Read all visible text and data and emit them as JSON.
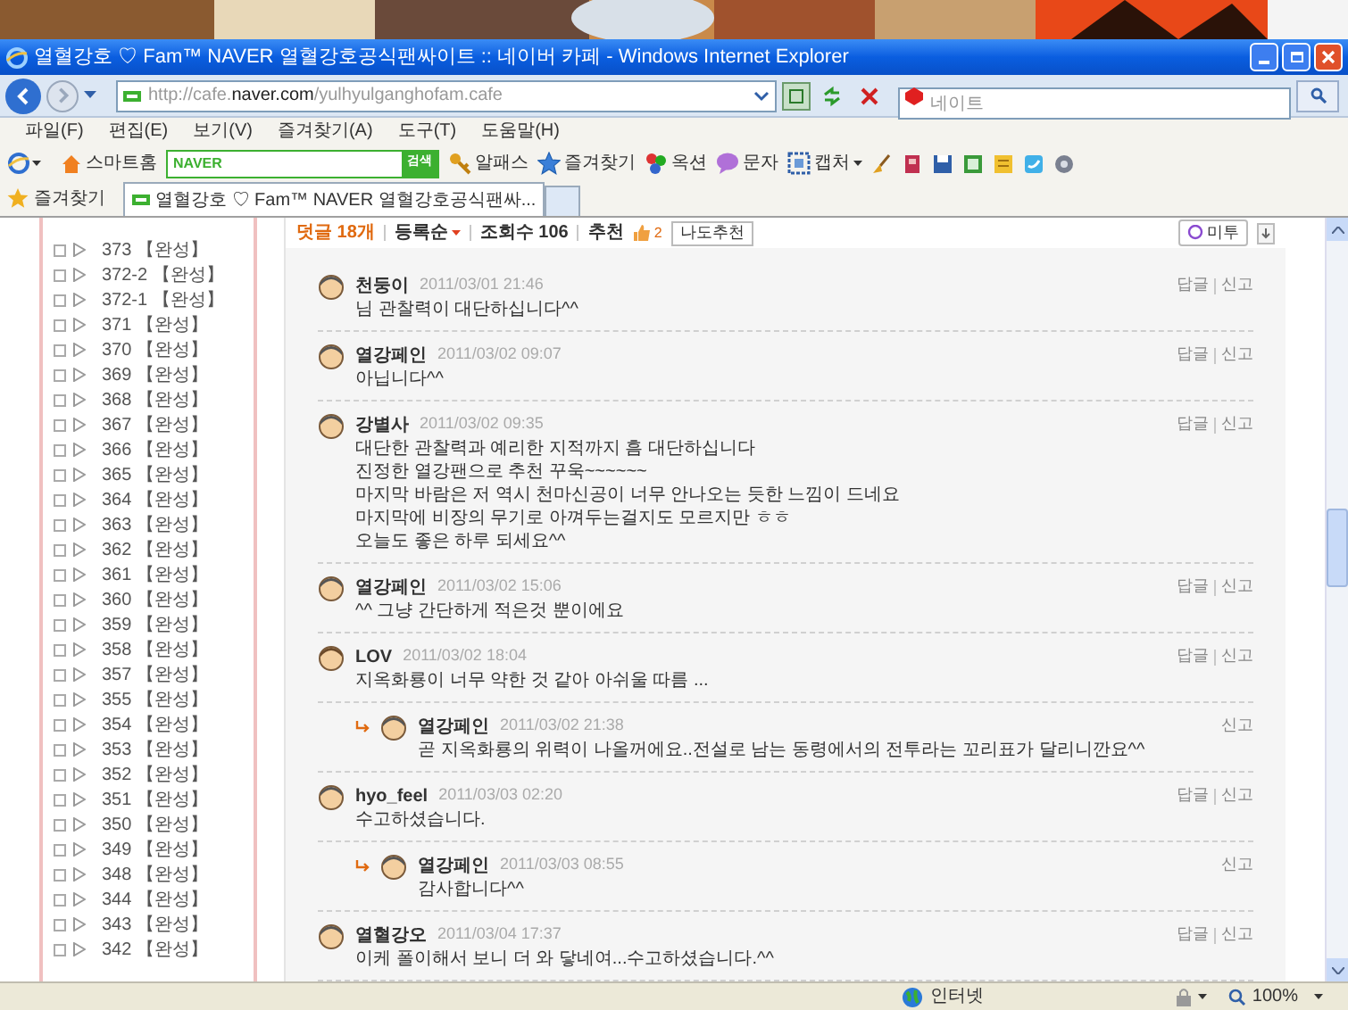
{
  "window": {
    "title": "열혈강호 ♡ Fam™ NAVER 열혈강호공식팬싸이트 :: 네이버 카페 - Windows Internet Explorer"
  },
  "address_bar": {
    "url": "http://cafe.**naver.com**/yulhyulganghofam.cafe"
  },
  "search": {
    "placeholder": "네이트"
  },
  "menu": [
    "파일(F)",
    "편집(E)",
    "보기(V)",
    "즐겨찾기(A)",
    "도구(T)",
    "도움말(H)"
  ],
  "toolbar": {
    "home": "스마트홈",
    "naver_logo": "NAVER",
    "naver_button": "검색",
    "items": [
      {
        "kind": "key",
        "label": "알패스"
      },
      {
        "kind": "star",
        "label": "즐겨찾기"
      },
      {
        "kind": "dots",
        "label": "옥션"
      },
      {
        "kind": "bubble",
        "label": "문자"
      },
      {
        "kind": "capture",
        "label": "캡처"
      }
    ]
  },
  "favorites": {
    "label": "즐겨찾기",
    "tabs": [
      {
        "title": "열혈강호 ♡ Fam™ NAVER 열혈강호공식팬싸...",
        "selected": true
      }
    ]
  },
  "sidebar": {
    "items": [
      "373 【완성】",
      "372-2 【완성】",
      "372-1 【완성】",
      "371 【완성】",
      "370 【완성】",
      "369 【완성】",
      "368 【완성】",
      "367 【완성】",
      "366 【완성】",
      "365 【완성】",
      "364 【완성】",
      "363 【완성】",
      "362 【완성】",
      "361 【완성】",
      "360 【완성】",
      "359 【완성】",
      "358 【완성】",
      "357 【완성】",
      "355 【완성】",
      "354 【완성】",
      "353 【완성】",
      "352 【완성】",
      "351 【완성】",
      "350 【완성】",
      "349 【완성】",
      "348 【완성】",
      "344 【완성】",
      "343 【완성】",
      "342 【완성】"
    ]
  },
  "comments_header": {
    "count": "덧글 18개",
    "sort": "등록순",
    "views": "조회수 106",
    "recommend": "추천",
    "likes": "2",
    "recommend_button": "나도추천",
    "me2_button": "미투"
  },
  "comments": [
    {
      "kind": "comment",
      "author": "천둥이",
      "date": "2011/03/01 21:46",
      "text": "님 관찰력이 대단하십니다^^",
      "actions": [
        "답글",
        "신고"
      ]
    },
    {
      "kind": "comment",
      "author": "열강페인",
      "date": "2011/03/02 09:07",
      "text": "아닙니다^^",
      "actions": [
        "답글",
        "신고"
      ]
    },
    {
      "kind": "comment",
      "author": "강별사",
      "date": "2011/03/02 09:35",
      "text": "대단한 관찰력과 예리한 지적까지 흠 대단하십니다\n진정한 열강팬으로 추천 꾸욱~~~~~~\n마지막 바람은 저 역시 천마신공이 너무 안나오는 듯한 느낌이 드네요\n마지막에 비장의 무기로 아껴두는걸지도 모르지만 ㅎㅎ\n오늘도 좋은 하루 되세요^^",
      "actions": [
        "답글",
        "신고"
      ]
    },
    {
      "kind": "comment",
      "author": "열강페인",
      "date": "2011/03/02 15:06",
      "text": "^^ 그냥 간단하게 적은것 뿐이에요",
      "actions": [
        "답글",
        "신고"
      ]
    },
    {
      "kind": "comment",
      "author": "LOV",
      "date": "2011/03/02 18:04",
      "text": "지옥화룡이 너무 약한 것 같아 아쉬울 따름 ...",
      "actions": [
        "답글",
        "신고"
      ]
    },
    {
      "kind": "reply",
      "author": "열강페인",
      "date": "2011/03/02 21:38",
      "text": "곧 지옥화룡의 위력이 나올꺼에요..전설로 남는 동령에서의 전투라는 꼬리표가 달리니깐요^^",
      "actions": [
        "신고"
      ]
    },
    {
      "kind": "comment",
      "author": "hyo_feel",
      "date": "2011/03/03 02:20",
      "text": "수고하셨습니다.",
      "actions": [
        "답글",
        "신고"
      ]
    },
    {
      "kind": "reply",
      "author": "열강페인",
      "date": "2011/03/03 08:55",
      "text": "감사합니다^^",
      "actions": [
        "신고"
      ]
    },
    {
      "kind": "comment",
      "author": "열혈강오",
      "date": "2011/03/04 17:37",
      "text": "이케 폴이해서 보니 더 와 닿네여...수고하셨습니다.^^",
      "actions": [
        "답글",
        "신고"
      ]
    }
  ],
  "status_bar": {
    "zone": "인터넷",
    "zoom": "100%"
  }
}
